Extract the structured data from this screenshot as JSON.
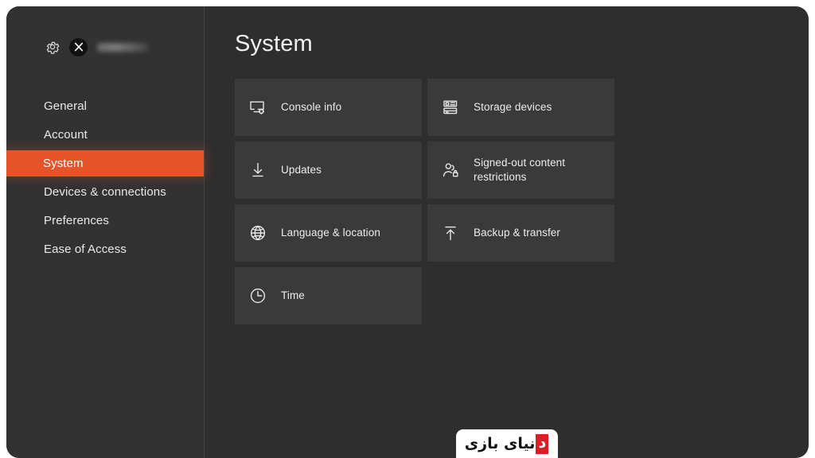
{
  "window": {
    "background_color": "#2e2e2e",
    "accent_color": "#e4552a"
  },
  "sidebar": {
    "background_color": "#323232",
    "gear_icon": "gear-icon",
    "profile_badge_icon": "xbox-logo-icon",
    "gamertag": "",
    "items": [
      {
        "label": "General",
        "selected": false
      },
      {
        "label": "Account",
        "selected": false
      },
      {
        "label": "System",
        "selected": true
      },
      {
        "label": "Devices & connections",
        "selected": false
      },
      {
        "label": "Preferences",
        "selected": false
      },
      {
        "label": "Ease of Access",
        "selected": false
      }
    ]
  },
  "main": {
    "title": "System",
    "tiles": [
      {
        "label": "Console info",
        "icon": "monitor-gear-icon"
      },
      {
        "label": "Storage devices",
        "icon": "storage-drive-icon"
      },
      {
        "label": "Updates",
        "icon": "download-arrow-icon"
      },
      {
        "label": "Signed-out content\nrestrictions",
        "icon": "people-lock-icon"
      },
      {
        "label": "Language & location",
        "icon": "globe-icon"
      },
      {
        "label": "Backup & transfer",
        "icon": "upload-arrow-icon"
      },
      {
        "label": "Time",
        "icon": "clock-icon"
      }
    ]
  },
  "watermark": {
    "text_red": "د",
    "text_black": "نیای بازی",
    "red_color": "#d81f26"
  }
}
